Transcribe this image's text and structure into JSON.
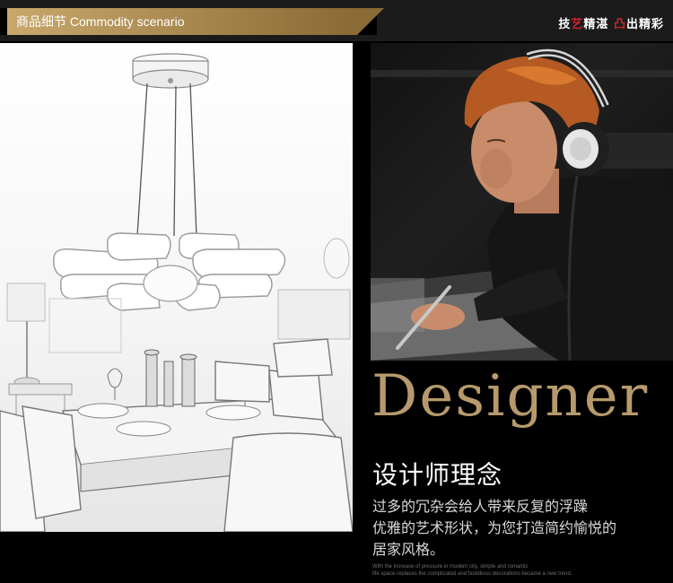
{
  "header": {
    "title_cn": "商品细节",
    "title_en": "Commodity scenario",
    "tagline_part1": "技",
    "tagline_part2": "艺",
    "tagline_part3": "精湛",
    "tagline_part4": "凸",
    "tagline_part5": "出精彩"
  },
  "designer": {
    "heading": "Designer",
    "subheading": "设计师理念",
    "description_line1": "过多的冗杂会给人带来反复的浮躁",
    "description_line2": "优雅的艺术形状，为您打造简约愉悦的",
    "description_line3": "居家风格。",
    "small_text_line1": "With the increase of pressure in modern city, simple and romantic",
    "small_text_line2": "life space replaces the complicated and fastidious decorations became a new trend."
  },
  "colors": {
    "gold": "#b79a6c",
    "red_accent": "#d2222a",
    "background": "#000000"
  }
}
